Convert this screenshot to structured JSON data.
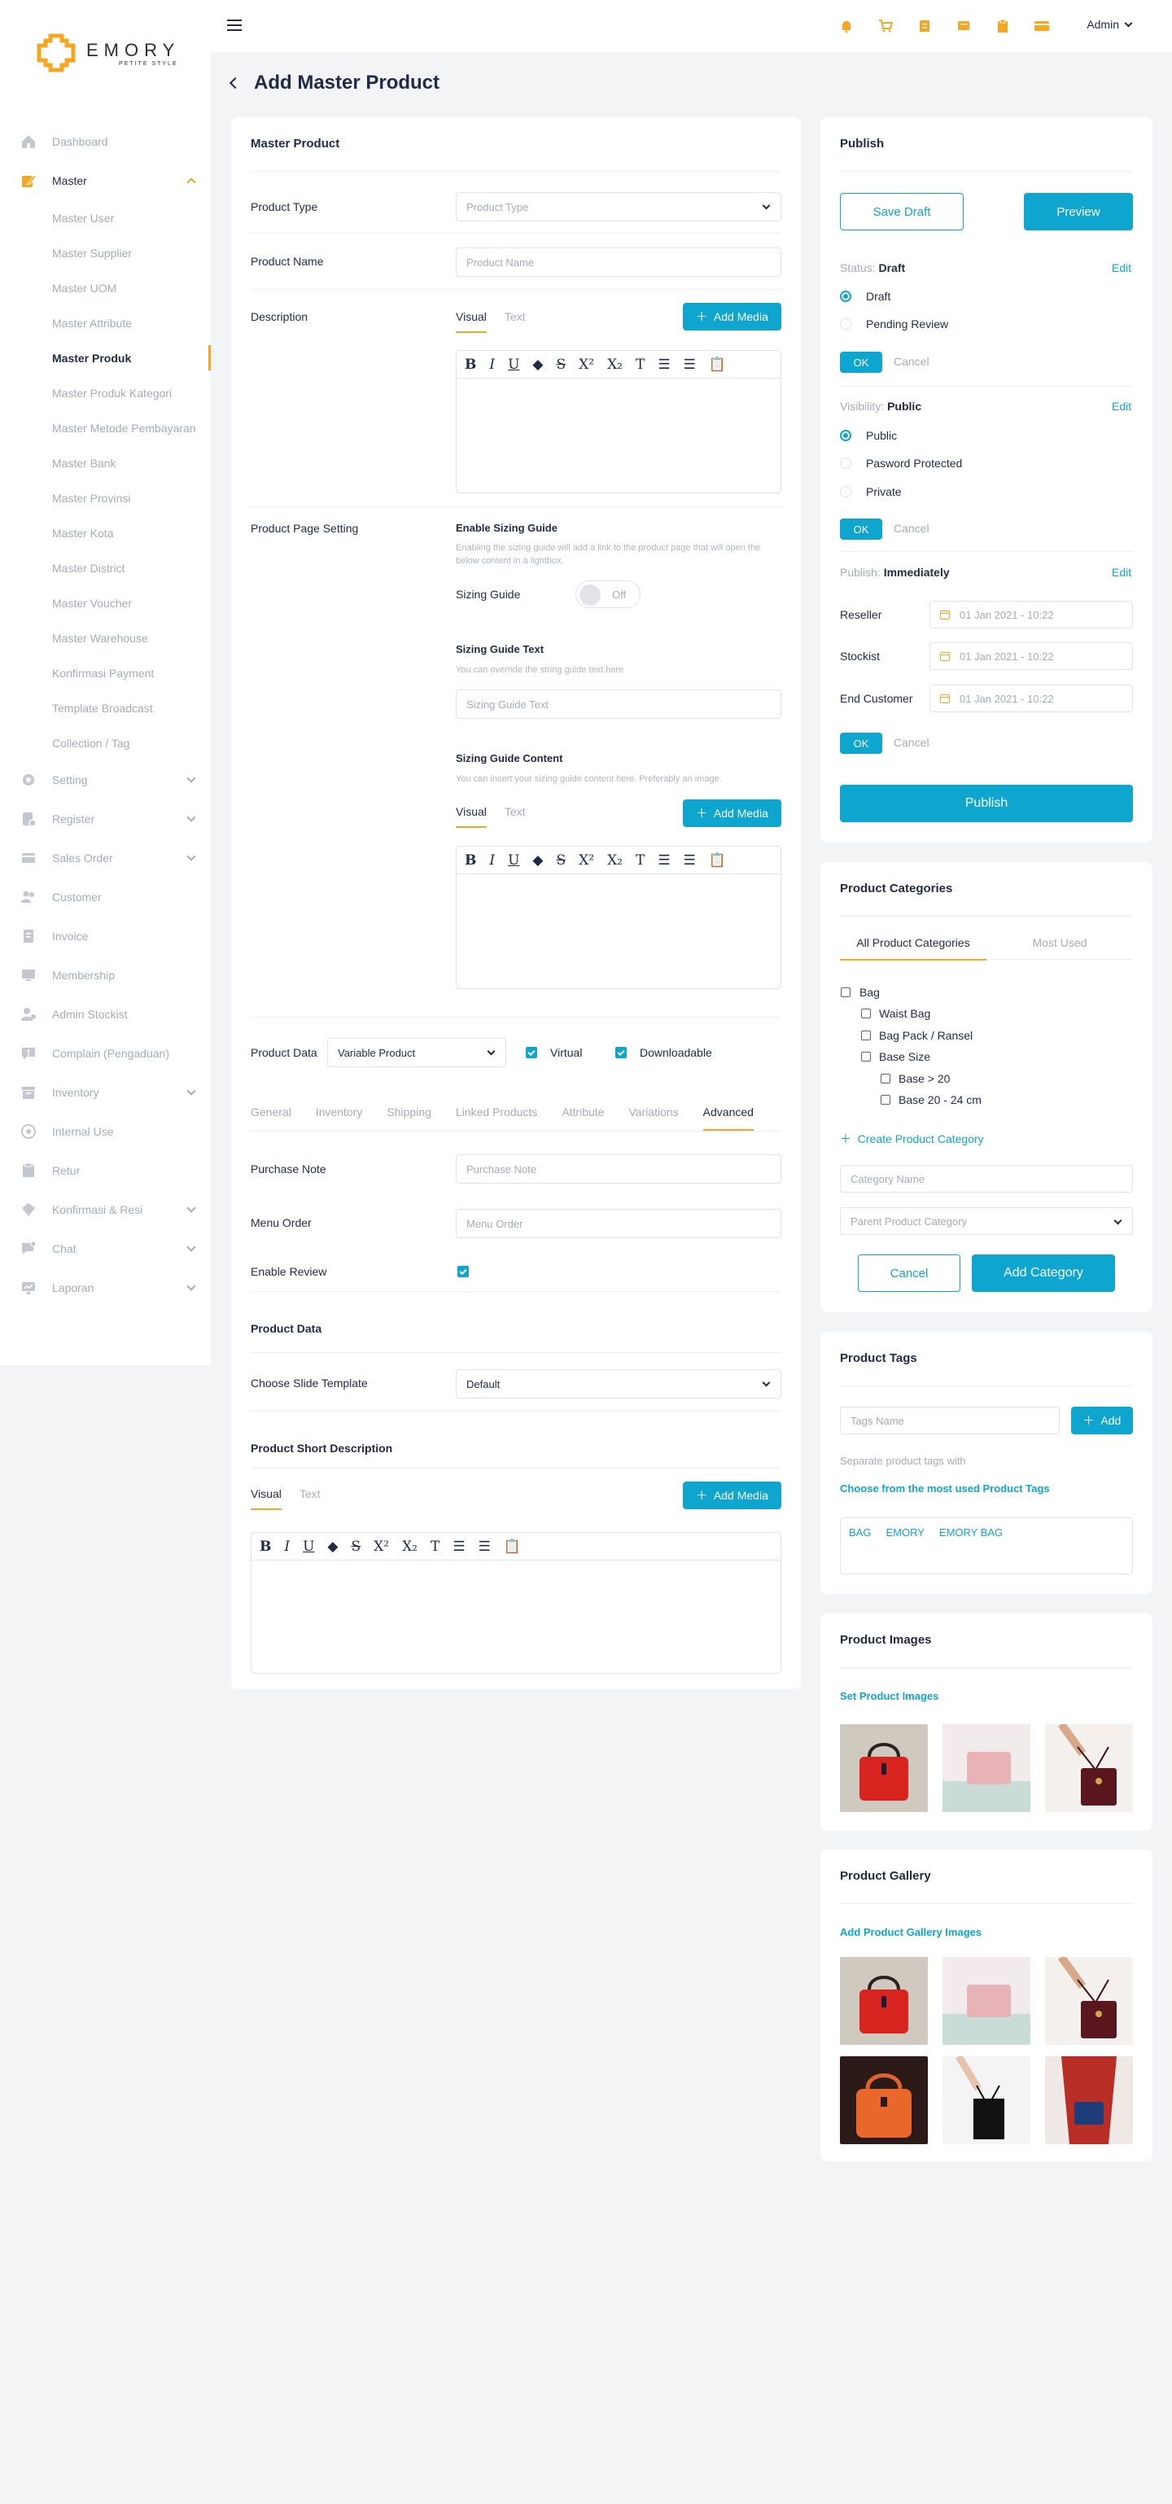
{
  "brand": {
    "name": "EMORY",
    "tagline": "PETITE STYLE",
    "accent": "#f5a623",
    "primary": "#0ea5cf"
  },
  "sidebar": {
    "items": [
      {
        "label": "Dashboard",
        "icon": "home-icon"
      },
      {
        "label": "Master",
        "icon": "edit-icon"
      },
      {
        "label": "Setting",
        "icon": "gear-icon"
      },
      {
        "label": "Register",
        "icon": "register-icon"
      },
      {
        "label": "Sales Order",
        "icon": "sales-order-icon"
      },
      {
        "label": "Customer",
        "icon": "customer-icon"
      },
      {
        "label": "Invoice",
        "icon": "invoice-icon"
      },
      {
        "label": "Membership",
        "icon": "membership-icon"
      },
      {
        "label": "Admin Stockist",
        "icon": "admin-stockist-icon"
      },
      {
        "label": "Complain (Pengaduan)",
        "icon": "complain-icon"
      },
      {
        "label": "Inventory",
        "icon": "inventory-icon"
      },
      {
        "label": "Internal Use",
        "icon": "internal-use-icon"
      },
      {
        "label": "Retur",
        "icon": "retur-icon"
      },
      {
        "label": "Konfirmasi & Resi",
        "icon": "konfirmasi-icon"
      },
      {
        "label": "Chat",
        "icon": "chat-icon"
      },
      {
        "label": "Laporan",
        "icon": "laporan-icon"
      }
    ],
    "master_sub": [
      "Master User",
      "Master Supplier",
      "Master UOM",
      "Master Attribute",
      "Master Produk",
      "Master Produk Kategori",
      "Master Metode Pembayaran",
      "Master Bank",
      "Master Provinsi",
      "Master Kota",
      "Master District",
      "Master Voucher",
      "Master Warehouse",
      "Konfirmasi Payment",
      "Template Broadcast",
      "Collection / Tag"
    ]
  },
  "topbar": {
    "admin_label": "Admin"
  },
  "page": {
    "title": "Add Master Product"
  },
  "master": {
    "title": "Master Product",
    "product_type_label": "Product Type",
    "product_type_placeholder": "Product Type",
    "product_name_label": "Product Name",
    "product_name_placeholder": "Product Name",
    "description_label": "Description",
    "tab_visual": "Visual",
    "tab_text": "Text",
    "add_media": "Add Media",
    "page_setting_label": "Product Page Setting",
    "sizing_title": "Enable Sizing Guide",
    "sizing_help": "Enabling the sizing guide will add a link to the product page that will open the below content in a lightbox.",
    "sizing_guide_label": "Sizing Guide",
    "toggle_off": "Off",
    "sizing_text_title": "Sizing Guide Text",
    "sizing_text_help": "You can override the string guide text here",
    "sizing_text_placeholder": "Sizing Guide Text",
    "sizing_content_title": "Sizing Guide Content",
    "sizing_content_help": "You can insert your sizing guide content here. Preferably an image.",
    "product_data_label": "Product Data",
    "product_data_value": "Variable Product",
    "virtual_label": "Virtual",
    "downloadable_label": "Downloadable",
    "data_tabs": [
      "General",
      "Inventory",
      "Shipping",
      "Linked Products",
      "Attribute",
      "Variations",
      "Advanced"
    ],
    "purchase_note_label": "Purchase Note",
    "purchase_note_placeholder": "Purchase Note",
    "menu_order_label": "Menu Order",
    "menu_order_placeholder": "Menu Order",
    "enable_review_label": "Enable Review",
    "product_data_title": "Product Data",
    "slide_template_label": "Choose Slide Template",
    "slide_template_value": "Default",
    "short_desc_title": "Product Short Description"
  },
  "publish": {
    "title": "Publish",
    "save_draft": "Save Draft",
    "preview": "Preview",
    "status_label": "Status:",
    "status_value": "Draft",
    "edit": "Edit",
    "status_options": [
      "Draft",
      "Pending Review"
    ],
    "ok": "OK",
    "cancel": "Cancel",
    "visibility_label": "Visibility:",
    "visibility_value": "Public",
    "visibility_options": [
      "Public",
      "Pasword Protected",
      "Private"
    ],
    "publish_label": "Publish:",
    "publish_value": "Immediately",
    "reseller_label": "Reseller",
    "stockist_label": "Stockist",
    "end_customer_label": "End Customer",
    "date_value": "01 Jan 2021 - 10:22",
    "publish_button": "Publish"
  },
  "categories": {
    "title": "Product Categories",
    "tab_all": "All Product Categories",
    "tab_most": "Most Used",
    "items": [
      "Bag",
      "Waist Bag",
      "Bag Pack / Ransel",
      "Base Size",
      "Base > 20",
      "Base 20 - 24 cm"
    ],
    "create_link": "Create Product Category",
    "category_name_placeholder": "Category Name",
    "parent_placeholder": "Parent Product Category",
    "cancel": "Cancel",
    "add": "Add Category"
  },
  "tags": {
    "title": "Product Tags",
    "placeholder": "Tags Name",
    "add": "Add",
    "help": "Separate product tags with",
    "choose_link": "Choose from the most used Product Tags",
    "values": [
      "BAG",
      "EMORY",
      "EMORY BAG"
    ]
  },
  "images": {
    "title": "Product Images",
    "set_link": "Set Product Images"
  },
  "gallery": {
    "title": "Product Gallery",
    "add_link": "Add Product Gallery Images"
  }
}
